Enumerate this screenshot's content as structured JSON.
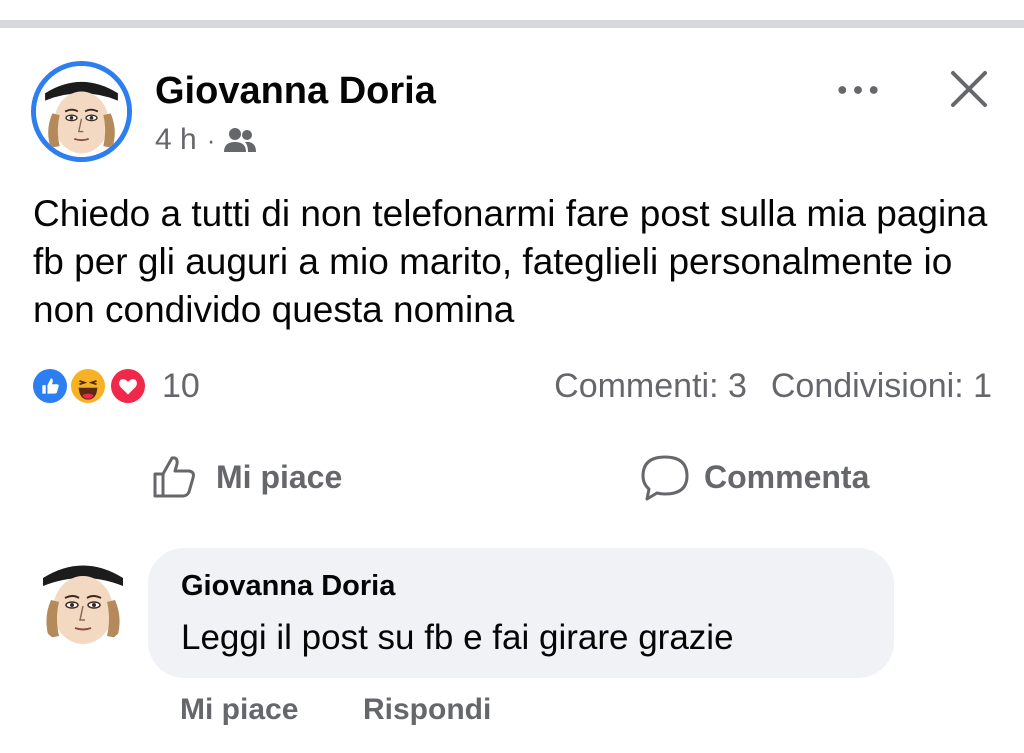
{
  "post": {
    "author": "Giovanna Doria",
    "time": "4 h",
    "separator": "·",
    "audience_icon": "friends-icon",
    "text": "Chiedo a tutti di non telefonarmi fare post sulla mia pagina fb per gli auguri a mio marito, fateglieli personalmente io non condivido questa nomina",
    "reactions": {
      "icons": [
        "like-reaction-icon",
        "haha-reaction-icon",
        "love-reaction-icon"
      ],
      "count": "10"
    },
    "comments_count": "Commenti: 3",
    "shares_count": "Condivisioni: 1",
    "actions": {
      "like": "Mi piace",
      "comment": "Commenta"
    }
  },
  "comment": {
    "author": "Giovanna Doria",
    "text": "Leggi il post su fb e fai girare grazie",
    "actions": {
      "like": "Mi piace",
      "reply": "Rispondi"
    }
  },
  "colors": {
    "accent_blue": "#2d7ef0",
    "secondary_text": "#65676b",
    "bubble_bg": "#f0f2f5",
    "love_red": "#f0284a",
    "haha_yellow": "#f7b125"
  }
}
